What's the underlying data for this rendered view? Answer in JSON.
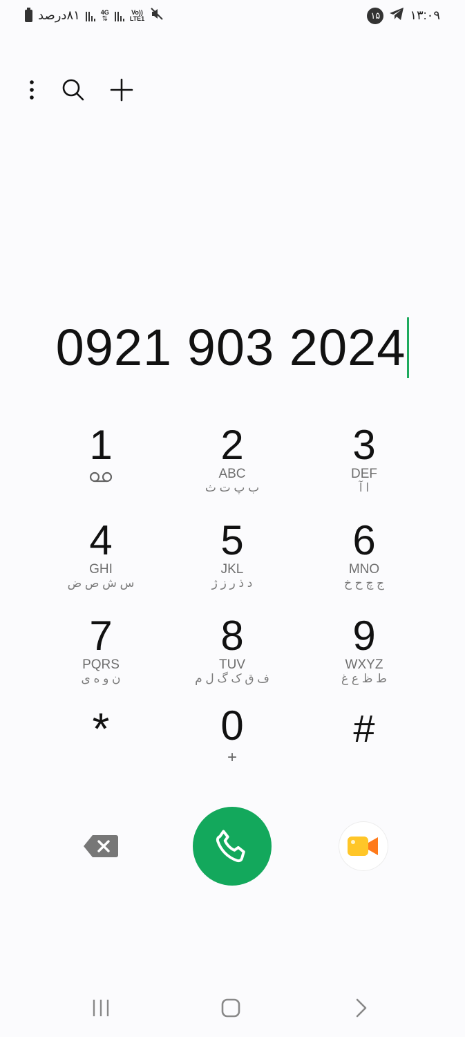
{
  "status_bar": {
    "battery_text": "۸۱درصد",
    "network_4g": "4G",
    "volte_top": "Vo))",
    "volte_bottom": "LTE1",
    "notification_count": "۱۵",
    "time": "۱۳:۰۹"
  },
  "toolbar": {
    "menu_icon": "more-vertical-icon",
    "search_icon": "search-icon",
    "add_icon": "plus-icon"
  },
  "dialer": {
    "number": "0921 903 2024"
  },
  "keypad": {
    "keys": [
      {
        "digit": "1",
        "letters": "",
        "persian": "",
        "sub_icon": "voicemail-icon"
      },
      {
        "digit": "2",
        "letters": "ABC",
        "persian": "ب پ ت ث"
      },
      {
        "digit": "3",
        "letters": "DEF",
        "persian": "ا آ"
      },
      {
        "digit": "4",
        "letters": "GHI",
        "persian": "س ش ص ض"
      },
      {
        "digit": "5",
        "letters": "JKL",
        "persian": "د ذ ر ز ژ"
      },
      {
        "digit": "6",
        "letters": "MNO",
        "persian": "ج چ ح خ"
      },
      {
        "digit": "7",
        "letters": "PQRS",
        "persian": "ن و ه ی"
      },
      {
        "digit": "8",
        "letters": "TUV",
        "persian": "ف ق ک گ ل م"
      },
      {
        "digit": "9",
        "letters": "WXYZ",
        "persian": "ط ظ ع غ"
      },
      {
        "digit": "*",
        "letters": "",
        "persian": ""
      },
      {
        "digit": "0",
        "letters": "+",
        "persian": ""
      },
      {
        "digit": "#",
        "letters": "",
        "persian": ""
      }
    ]
  },
  "actions": {
    "backspace_icon": "backspace-icon",
    "call_icon": "phone-icon",
    "video_icon": "video-call-icon"
  },
  "nav_bar": {
    "recents_icon": "recent-apps-icon",
    "home_icon": "home-icon",
    "back_icon": "back-icon"
  },
  "colors": {
    "call_green": "#13a85c",
    "cursor_green": "#1eaa5e",
    "video_yellow": "#ffc628"
  }
}
